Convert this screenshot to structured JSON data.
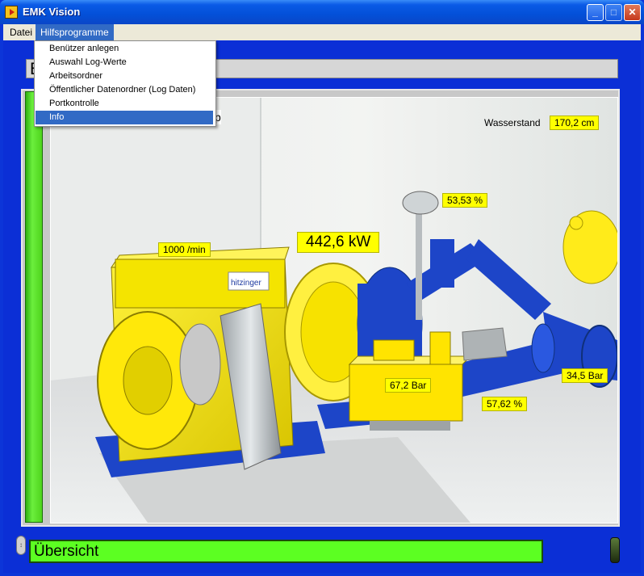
{
  "window": {
    "title": "EMK Vision",
    "buttons": {
      "minimize": "_",
      "maximize": "□",
      "close": "✕"
    }
  },
  "menubar": {
    "items": [
      {
        "label": "Datei"
      },
      {
        "label": "Hilfsprogramme"
      }
    ]
  },
  "dropdown": {
    "items": [
      {
        "label": "Benützer anlegen"
      },
      {
        "label": "Auswahl Log-Werte"
      },
      {
        "label": "Arbeitsordner"
      },
      {
        "label": "Öffentlicher Datenordner (Log Daten)"
      },
      {
        "label": "Portkontrolle"
      },
      {
        "label": "Info"
      }
    ],
    "selected": "Info",
    "trailing_char": "p"
  },
  "top_panel": {
    "text": "E"
  },
  "readouts": {
    "wasserstand_label": "Wasserstand",
    "wasserstand_value": "170,2 cm",
    "drehzahl": "1000 /min",
    "leistung": "442,6 kW",
    "oeffnung_oben": "53,53 %",
    "druck_hydraulik": "67,2 Bar",
    "oeffnung_unten": "57,62 %",
    "druck_leitung": "34,5 Bar"
  },
  "bottom": {
    "view_name": "Übersicht"
  },
  "colors": {
    "window_blue": "#0b2fd6",
    "readout_yellow": "#ffff00",
    "status_green": "#5cff22",
    "menu_highlight": "#316ac5"
  }
}
